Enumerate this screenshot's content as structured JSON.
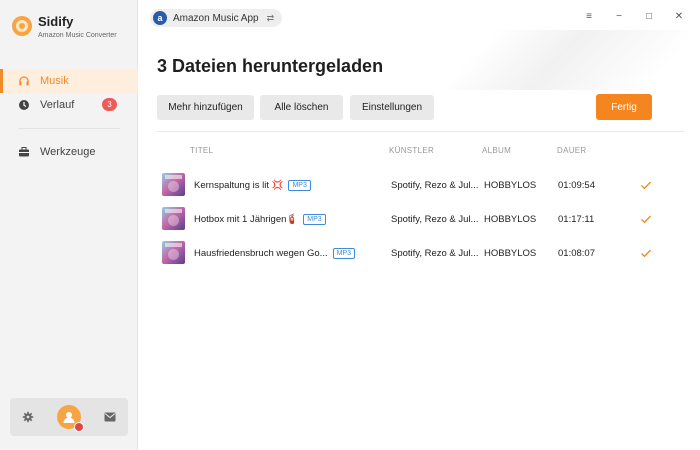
{
  "app": {
    "name": "Sidify",
    "subtitle": "Amazon Music Converter"
  },
  "sidebar": {
    "items": [
      {
        "label": "Musik",
        "icon": "headphones-icon",
        "active": true
      },
      {
        "label": "Verlauf",
        "icon": "clock-icon",
        "badge": "3"
      },
      {
        "label": "Werkzeuge",
        "icon": "toolbox-icon"
      }
    ],
    "bottom": {
      "settings_icon": "gear-icon",
      "avatar_icon": "user-avatar-icon",
      "mail_icon": "mail-icon"
    }
  },
  "source": {
    "label": "Amazon Music App",
    "icon_letter": "a",
    "swap_icon": "⇄"
  },
  "window_controls": {
    "menu": "≡",
    "minimize": "−",
    "maximize": "□",
    "close": "✕"
  },
  "main": {
    "headline": "3 Dateien heruntergeladen",
    "buttons": {
      "add": "Mehr hinzufügen",
      "delete_all": "Alle löschen",
      "settings": "Einstellungen",
      "done": "Fertig"
    },
    "columns": {
      "title": "TITEL",
      "artist": "KÜNSTLER",
      "album": "ALBUM",
      "duration": "DAUER"
    },
    "rows": [
      {
        "title": "Kernspaltung is lit 💢",
        "format": "MP3",
        "artist": "Spotify, Rezo & Jul...",
        "album": "HOBBYLOS",
        "duration": "01:09:54"
      },
      {
        "title": "Hotbox mit 1 Jährigen🧯",
        "format": "MP3",
        "artist": "Spotify, Rezo & Jul...",
        "album": "HOBBYLOS",
        "duration": "01:17:11"
      },
      {
        "title": "Hausfriedensbruch wegen Go...",
        "format": "MP3",
        "artist": "Spotify, Rezo & Jul...",
        "album": "HOBBYLOS",
        "duration": "01:08:07"
      }
    ]
  },
  "colors": {
    "accent": "#f5861f",
    "badge": "#ef5a5a",
    "mp3_tag": "#3d8bd9"
  }
}
